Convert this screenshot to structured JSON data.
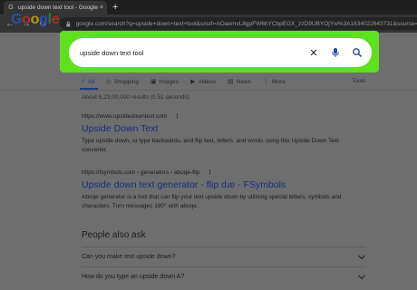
{
  "browser": {
    "tab_title": "upside down text tool - Google S",
    "tab_close": "×",
    "new_tab": "+",
    "url": "google.com/search?q=upside+down+text+tool&sxsrf=AOaemvL8gpFW6hYCbpEGX_zzD9UBYOjYw%3A1634022643731&source=hp&ei=8"
  },
  "logo": {
    "letters": [
      "G",
      "o",
      "o",
      "g",
      "l",
      "e"
    ],
    "colors": [
      "#2a4fa8",
      "#a83226",
      "#b89616",
      "#2a4fa8",
      "#2f7a3a",
      "#a83226"
    ]
  },
  "search": {
    "query": "upside down text tool",
    "clear_glyph": "✕",
    "highlight_color": "#5fe01d"
  },
  "tabs": {
    "items": [
      {
        "icon": "search-icon",
        "glyph": "⌕",
        "label": "All"
      },
      {
        "icon": "shopping-icon",
        "glyph": "◇",
        "label": "Shopping"
      },
      {
        "icon": "images-icon",
        "glyph": "▣",
        "label": "Images"
      },
      {
        "icon": "videos-icon",
        "glyph": "▶",
        "label": "Videos"
      },
      {
        "icon": "news-icon",
        "glyph": "▤",
        "label": "News"
      },
      {
        "icon": "more-icon",
        "glyph": "⋮",
        "label": "More"
      }
    ],
    "tools": "Tools"
  },
  "stats": "About 5,23,00,000 results (0.51 seconds)",
  "results": [
    {
      "cite": "https://www.upsidedowntext.com",
      "title": "Upside Down Text",
      "snippet": "Type upside down, or type backwards, and flip text, letters, and words using this Upside Down Text converter."
    },
    {
      "cite": "https://fsymbols.com › generators › aboqe-flip",
      "title": "Upside down text generator - flip dɹɐ - FSymbols",
      "snippet": "Aboqe generator is a tool that can flip your text upside down by utilising special letters, symbols and characters. Turn messages 180° with aboqe."
    }
  ],
  "people_also_ask": {
    "title": "People also ask",
    "questions": [
      "Can you make text upside down?",
      "How do you type an upside down A?"
    ]
  }
}
